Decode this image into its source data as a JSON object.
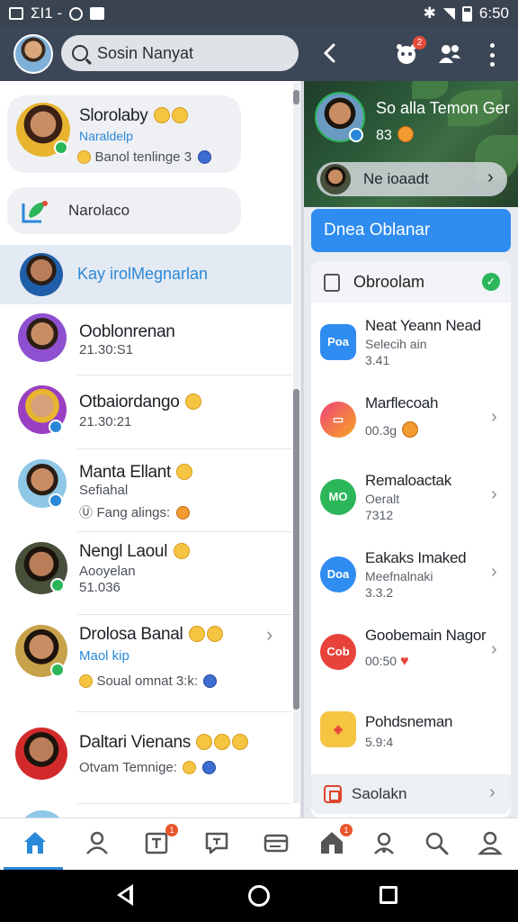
{
  "status_bar": {
    "carrier_text": "ΣΙ1 -",
    "time": "6:50"
  },
  "header": {
    "search_text": "Sosin Nanyat",
    "notification_badge": "2"
  },
  "left_panel": {
    "pinned_card_1": {
      "title": "Slorolaby",
      "subtitle": "Naraldelp",
      "preview": "Banol tenlinge 3"
    },
    "pinned_card_2": {
      "title": "Narolaco"
    },
    "highlighted_row": {
      "title": "Kay irolMegnarlan"
    },
    "chats": [
      {
        "title": "Ooblonrenan",
        "line2": "21.30:S1",
        "line3": ""
      },
      {
        "title": "Otbaiordango",
        "line2": "21.30:21",
        "line3": ""
      },
      {
        "title": "Manta Ellant",
        "line2": "Sefiahal",
        "line3": "Fang alings:"
      },
      {
        "title": "Nengl Laoul",
        "line2": "Aooyelan",
        "line3": "51.036"
      },
      {
        "title": "Drolosa Banal",
        "line2": "Maol kip",
        "line3": "Soual omnat 3:k:"
      },
      {
        "title": "Daltari Vienans",
        "line2": "Otvam Temnige:",
        "line3": ""
      }
    ]
  },
  "right_panel": {
    "hero": {
      "title": "So alla Temon Ger",
      "number": "83",
      "pill_label": "Ne ioaadt"
    },
    "primary_button": "Dnea Oblanar",
    "section_header": "Obroolam",
    "items": [
      {
        "icon_label": "Poa",
        "icon_color": "#2f8cf0",
        "title": "Neat Yeann Nead",
        "sub1": "Selecih ain",
        "sub2": "3.41"
      },
      {
        "icon_label": "",
        "icon_color": "#f0437a",
        "title": "Marflecoah",
        "sub1": "00.3g",
        "sub2": ""
      },
      {
        "icon_label": "MO",
        "icon_color": "#2bb65a",
        "title": "Remaloactak",
        "sub1": "Oeralt",
        "sub2": "7312"
      },
      {
        "icon_label": "Doa",
        "icon_color": "#2f8cf0",
        "title": "Eakaks Imaked",
        "sub1": "Meefnalnaki",
        "sub2": "3.3.2"
      },
      {
        "icon_label": "Cob",
        "icon_color": "#e8433a",
        "title": "Goobemain Nagor",
        "sub1": "00:50",
        "sub2": ""
      },
      {
        "icon_label": "",
        "icon_color": "#f5c542",
        "title": "Pohdsneman",
        "sub1": "5.9:4",
        "sub2": ""
      }
    ],
    "bottom_item": "Saolakn"
  },
  "tab_bar": {
    "tabs": [
      "home",
      "profile",
      "text",
      "chat",
      "card",
      "house",
      "contacts",
      "search",
      "account"
    ],
    "active": "home",
    "badge_text_tab": "1",
    "badge_house_tab": "1"
  },
  "colors": {
    "accent": "#2a88d8",
    "appbar": "#3b4757",
    "primary_button": "#2f8cf0"
  }
}
